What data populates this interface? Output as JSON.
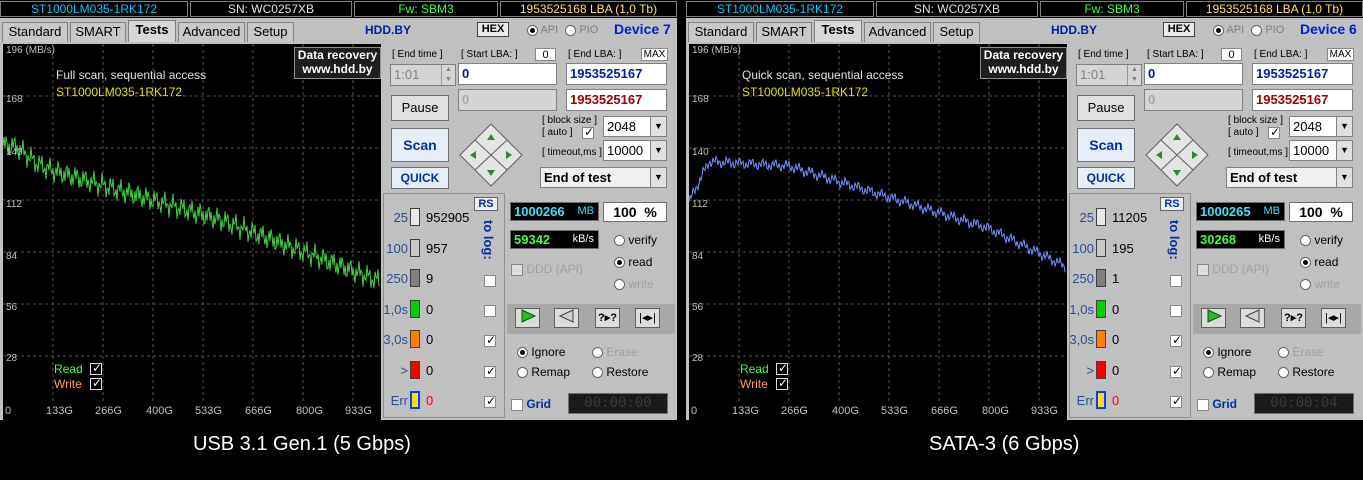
{
  "panels": [
    {
      "model": "ST1000LM035-1RK172",
      "serial": "SN: WC0257XB",
      "firmware": "Fw: SBM3",
      "lba_info": "1953525168 LBA (1,0 Tb)",
      "tabs": [
        "Standard",
        "SMART",
        "Tests",
        "Advanced",
        "Setup"
      ],
      "active_tab": "Tests",
      "site": "HDD.BY",
      "hex": "HEX",
      "api": "API",
      "pio": "PIO",
      "device": "Device 7",
      "graph": {
        "units": "196 (MB/s)",
        "y_ticks": [
          "168",
          "140",
          "112",
          "84",
          "56",
          "28"
        ],
        "x_ticks": [
          "0",
          "133G",
          "266G",
          "400G",
          "533G",
          "666G",
          "800G",
          "933G"
        ],
        "title": "Full scan, sequential access",
        "model": "ST1000LM035-1RK172",
        "read_label": "Read",
        "write_label": "Write",
        "data_recovery": "Data recovery",
        "site_url": "www.hdd.by",
        "trace_color": "#40d040"
      },
      "end_time_label": "[ End time ]",
      "end_time": "1:01",
      "start_lba_label": "[ Start LBA: ]",
      "start_lba_zero": "0",
      "start_lba": "0",
      "end_lba_label": "[ End LBA: ]",
      "end_lba_max": "MAX",
      "end_lba": "1953525167",
      "start_lba2": "0",
      "end_lba2": "1953525167",
      "pause": "Pause",
      "scan": "Scan",
      "quick": "QUICK",
      "block_size_label": "[ block size ]",
      "auto_label": "[ auto ]",
      "block_size": "2048",
      "timeout_label": "[ timeout,ms ]",
      "timeout": "10000",
      "status": "End of test",
      "rs": "RS",
      "to_log": "to log:",
      "legend": [
        {
          "name": "25",
          "count": "952905",
          "color": "#e8e8e8"
        },
        {
          "name": "100",
          "count": "957",
          "color": "#c8c8c8"
        },
        {
          "name": "250",
          "count": "9",
          "color": "#808080"
        },
        {
          "name": "1,0s",
          "count": "0",
          "color": "#00d000"
        },
        {
          "name": "3,0s",
          "count": "0",
          "color": "#ff8000"
        },
        {
          "name": ">",
          "count": "0",
          "color": "#ff0000"
        },
        {
          "name": "Err",
          "count": "0",
          "color": "#0040ff"
        }
      ],
      "mb": "1000266",
      "mb_unit": "MB",
      "percent": "100",
      "percent_sign": "%",
      "speed": "59342",
      "speed_unit": "kB/s",
      "verify": "verify",
      "read": "read",
      "write": "write",
      "ddd": "DDD (API)",
      "ignore": "Ignore",
      "erase": "Erase",
      "remap": "Remap",
      "restore": "Restore",
      "grid": "Grid",
      "timer": "00:00:00",
      "caption": "USB 3.1 Gen.1 (5 Gbps)"
    },
    {
      "model": "ST1000LM035-1RK172",
      "serial": "SN: WC0257XB",
      "firmware": "Fw: SBM3",
      "lba_info": "1953525168 LBA (1,0 Tb)",
      "tabs": [
        "Standard",
        "SMART",
        "Tests",
        "Advanced",
        "Setup"
      ],
      "active_tab": "Tests",
      "site": "HDD.BY",
      "hex": "HEX",
      "api": "API",
      "pio": "PIO",
      "device": "Device 6",
      "graph": {
        "units": "196 (MB/s)",
        "y_ticks": [
          "168",
          "140",
          "112",
          "84",
          "56",
          "28"
        ],
        "x_ticks": [
          "0",
          "133G",
          "266G",
          "400G",
          "533G",
          "666G",
          "800G",
          "933G"
        ],
        "title": "Quick scan, sequential access",
        "model": "ST1000LM035-1RK172",
        "read_label": "Read",
        "write_label": "Write",
        "data_recovery": "Data recovery",
        "site_url": "www.hdd.by",
        "trace_color": "#7090ff"
      },
      "end_time_label": "[ End time ]",
      "end_time": "1:01",
      "start_lba_label": "[ Start LBA: ]",
      "start_lba_zero": "0",
      "start_lba": "0",
      "end_lba_label": "[ End LBA: ]",
      "end_lba_max": "MAX",
      "end_lba": "1953525167",
      "start_lba2": "0",
      "end_lba2": "1953525167",
      "pause": "Pause",
      "scan": "Scan",
      "quick": "QUICK",
      "block_size_label": "[ block size ]",
      "auto_label": "[ auto ]",
      "block_size": "2048",
      "timeout_label": "[ timeout,ms ]",
      "timeout": "10000",
      "status": "End of test",
      "rs": "RS",
      "to_log": "to log:",
      "legend": [
        {
          "name": "25",
          "count": "11205",
          "color": "#e8e8e8"
        },
        {
          "name": "100",
          "count": "195",
          "color": "#c8c8c8"
        },
        {
          "name": "250",
          "count": "1",
          "color": "#808080"
        },
        {
          "name": "1,0s",
          "count": "0",
          "color": "#00d000"
        },
        {
          "name": "3,0s",
          "count": "0",
          "color": "#ff8000"
        },
        {
          "name": ">",
          "count": "0",
          "color": "#ff0000"
        },
        {
          "name": "Err",
          "count": "0",
          "color": "#0040ff"
        }
      ],
      "mb": "1000265",
      "mb_unit": "MB",
      "percent": "100",
      "percent_sign": "%",
      "speed": "30268",
      "speed_unit": "kB/s",
      "verify": "verify",
      "read": "read",
      "write": "write",
      "ddd": "DDD (API)",
      "ignore": "Ignore",
      "erase": "Erase",
      "remap": "Remap",
      "restore": "Restore",
      "grid": "Grid",
      "timer": "00:00:04",
      "caption": "SATA-3 (6 Gbps)"
    }
  ]
}
